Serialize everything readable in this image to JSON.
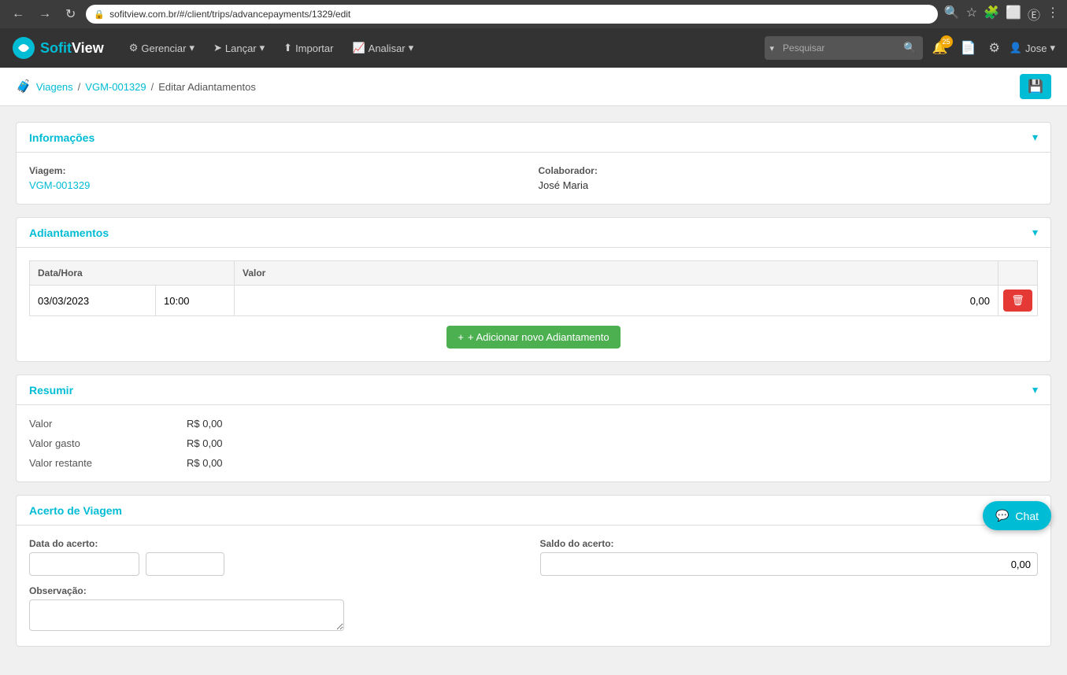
{
  "browser": {
    "url": "sofitview.com.br/#/client/trips/advancepayments/1329/edit"
  },
  "header": {
    "logo_sofit": "Sofit",
    "logo_view": "View",
    "nav": [
      {
        "label": "Gerenciar",
        "icon": "⚙"
      },
      {
        "label": "Lançar",
        "icon": "➤"
      },
      {
        "label": "Importar",
        "icon": "⬆"
      },
      {
        "label": "Analisar",
        "icon": "📈"
      }
    ],
    "search_placeholder": "Pesquisar",
    "notification_count": "25",
    "user_label": "Jose"
  },
  "breadcrumb": {
    "trips_label": "Viagens",
    "trip_id": "VGM-001329",
    "page_title": "Editar Adiantamentos"
  },
  "informacoes": {
    "section_title": "Informações",
    "viagem_label": "Viagem:",
    "viagem_value": "VGM-001329",
    "colaborador_label": "Colaborador:",
    "colaborador_value": "José Maria"
  },
  "adiantamentos": {
    "section_title": "Adiantamentos",
    "col_data_hora": "Data/Hora",
    "col_valor": "Valor",
    "rows": [
      {
        "data": "03/03/2023",
        "hora": "10:00",
        "valor": "0,00"
      }
    ],
    "add_btn_label": "+ Adicionar novo Adiantamento"
  },
  "resumir": {
    "section_title": "Resumir",
    "valor_label": "Valor",
    "valor_value": "R$ 0,00",
    "valor_gasto_label": "Valor gasto",
    "valor_gasto_value": "R$ 0,00",
    "valor_restante_label": "Valor restante",
    "valor_restante_value": "R$ 0,00"
  },
  "acerto_de_viagem": {
    "section_title": "Acerto de Viagem",
    "data_acerto_label": "Data do acerto:",
    "saldo_acerto_label": "Saldo do acerto:",
    "saldo_acerto_value": "0,00",
    "observacao_label": "Observação:"
  },
  "chat": {
    "label": "Chat"
  }
}
